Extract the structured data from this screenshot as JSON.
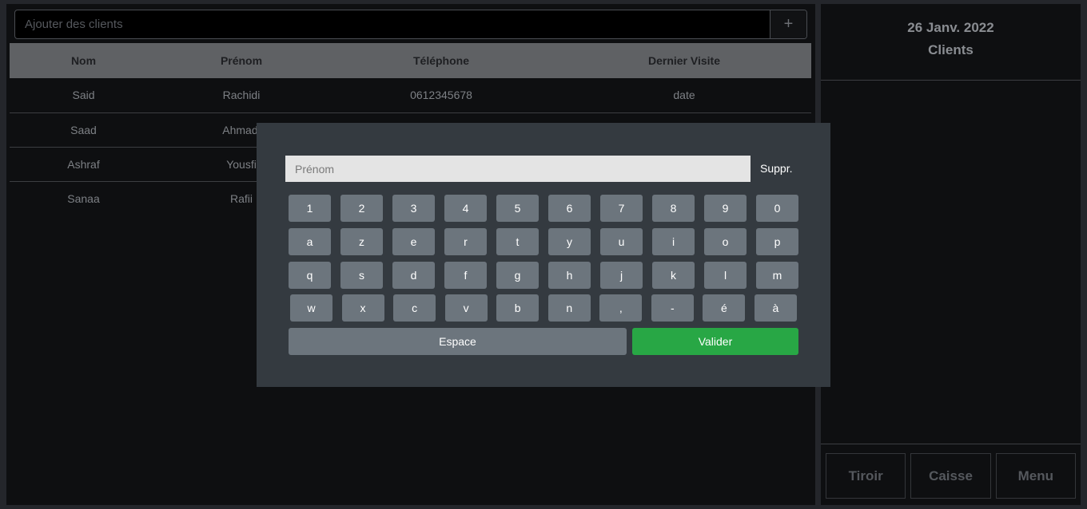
{
  "search": {
    "placeholder": "Ajouter des clients",
    "add_label": "+"
  },
  "table": {
    "headers": [
      "Nom",
      "Prénom",
      "Téléphone",
      "Dernier Visite"
    ],
    "rows": [
      [
        "Said",
        "Rachidi",
        "0612345678",
        "date"
      ],
      [
        "Saad",
        "Ahmadi",
        "",
        ""
      ],
      [
        "Ashraf",
        "Yousfi",
        "",
        ""
      ],
      [
        "Sanaa",
        "Rafii",
        "",
        ""
      ]
    ]
  },
  "side": {
    "date": "26 Janv. 2022",
    "title": "Clients",
    "buttons": [
      "Tiroir",
      "Caisse",
      "Menu"
    ]
  },
  "keyboard": {
    "input_placeholder": "Prénom",
    "delete_label": "Suppr.",
    "rows": [
      [
        "1",
        "2",
        "3",
        "4",
        "5",
        "6",
        "7",
        "8",
        "9",
        "0"
      ],
      [
        "a",
        "z",
        "e",
        "r",
        "t",
        "y",
        "u",
        "i",
        "o",
        "p"
      ],
      [
        "q",
        "s",
        "d",
        "f",
        "g",
        "h",
        "j",
        "k",
        "l",
        "m"
      ],
      [
        "w",
        "x",
        "c",
        "v",
        "b",
        "n",
        ",",
        "-",
        "é",
        "à"
      ]
    ],
    "space_label": "Espace",
    "validate_label": "Valider",
    "validate_color": "#28a745"
  }
}
